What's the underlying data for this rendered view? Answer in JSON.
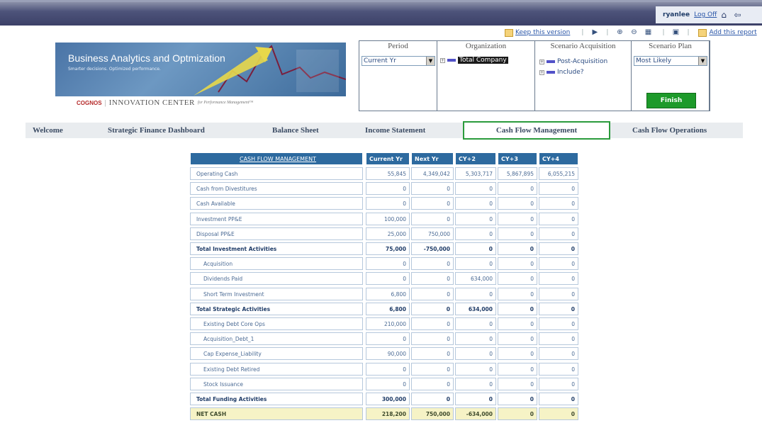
{
  "topbar": {
    "user": "ryanlee",
    "logoff": "Log Off"
  },
  "actions": {
    "keep_version": "Keep this version",
    "add_report": "Add this report"
  },
  "banner": {
    "title": "Business Analytics and Optmization",
    "subtitle": "Smarter decisions. Optimized performance.",
    "cognos": "COGNOS",
    "center": "INNOVATION CENTER",
    "for_text": "for Performance Management™"
  },
  "prompts": {
    "period": {
      "header": "Period",
      "value": "Current Yr"
    },
    "organization": {
      "header": "Organization",
      "item": "Total Company"
    },
    "scenario_acquisition": {
      "header": "Scenario Acquisition",
      "items": [
        "Post-Acquisition",
        "Include?"
      ]
    },
    "scenario_plan": {
      "header": "Scenario Plan",
      "value": "Most Likely"
    },
    "finish_label": "Finish"
  },
  "nav": {
    "tabs": [
      "Welcome",
      "Strategic Finance Dashboard",
      "Balance Sheet",
      "Income Statement",
      "Cash Flow Management",
      "Cash Flow Operations"
    ],
    "active": "Cash Flow Management"
  },
  "table": {
    "title": "CASH FLOW MANAGEMENT",
    "columns": [
      "Current Yr",
      "Next Yr",
      "CY+2",
      "CY+3",
      "CY+4"
    ],
    "rows": [
      {
        "label": "Operating Cash",
        "values": [
          "55,845",
          "4,349,042",
          "5,303,717",
          "5,867,895",
          "6,055,215"
        ],
        "type": "normal"
      },
      {
        "label": "Cash from Divestitures",
        "values": [
          "0",
          "0",
          "0",
          "0",
          "0"
        ],
        "type": "normal"
      },
      {
        "label": "Cash Available",
        "values": [
          "0",
          "0",
          "0",
          "0",
          "0"
        ],
        "type": "normal"
      },
      {
        "label": "Investment PP&E",
        "values": [
          "100,000",
          "0",
          "0",
          "0",
          "0"
        ],
        "type": "normal"
      },
      {
        "label": "Disposal PP&E",
        "values": [
          "25,000",
          "750,000",
          "0",
          "0",
          "0"
        ],
        "type": "normal"
      },
      {
        "label": "Total Investment Activities",
        "values": [
          "75,000",
          "-750,000",
          "0",
          "0",
          "0"
        ],
        "type": "total"
      },
      {
        "label": "Acquisition",
        "values": [
          "0",
          "0",
          "0",
          "0",
          "0"
        ],
        "type": "indent"
      },
      {
        "label": "Dividends Paid",
        "values": [
          "0",
          "0",
          "634,000",
          "0",
          "0"
        ],
        "type": "indent"
      },
      {
        "label": "Short Term Investment",
        "values": [
          "6,800",
          "0",
          "0",
          "0",
          "0"
        ],
        "type": "indent"
      },
      {
        "label": "Total Strategic Activities",
        "values": [
          "6,800",
          "0",
          "634,000",
          "0",
          "0"
        ],
        "type": "total"
      },
      {
        "label": "Existing Debt Core Ops",
        "values": [
          "210,000",
          "0",
          "0",
          "0",
          "0"
        ],
        "type": "indent"
      },
      {
        "label": "Acquisition_Debt_1",
        "values": [
          "0",
          "0",
          "0",
          "0",
          "0"
        ],
        "type": "indent"
      },
      {
        "label": "Cap Expense_Liability",
        "values": [
          "90,000",
          "0",
          "0",
          "0",
          "0"
        ],
        "type": "indent"
      },
      {
        "label": "Existing Debt Retired",
        "values": [
          "0",
          "0",
          "0",
          "0",
          "0"
        ],
        "type": "indent"
      },
      {
        "label": "Stock Issuance",
        "values": [
          "0",
          "0",
          "0",
          "0",
          "0"
        ],
        "type": "indent"
      },
      {
        "label": "Total Funding Activities",
        "values": [
          "300,000",
          "0",
          "0",
          "0",
          "0"
        ],
        "type": "total"
      },
      {
        "label": "NET CASH",
        "values": [
          "218,200",
          "750,000",
          "-634,000",
          "0",
          "0"
        ],
        "type": "net"
      }
    ]
  }
}
